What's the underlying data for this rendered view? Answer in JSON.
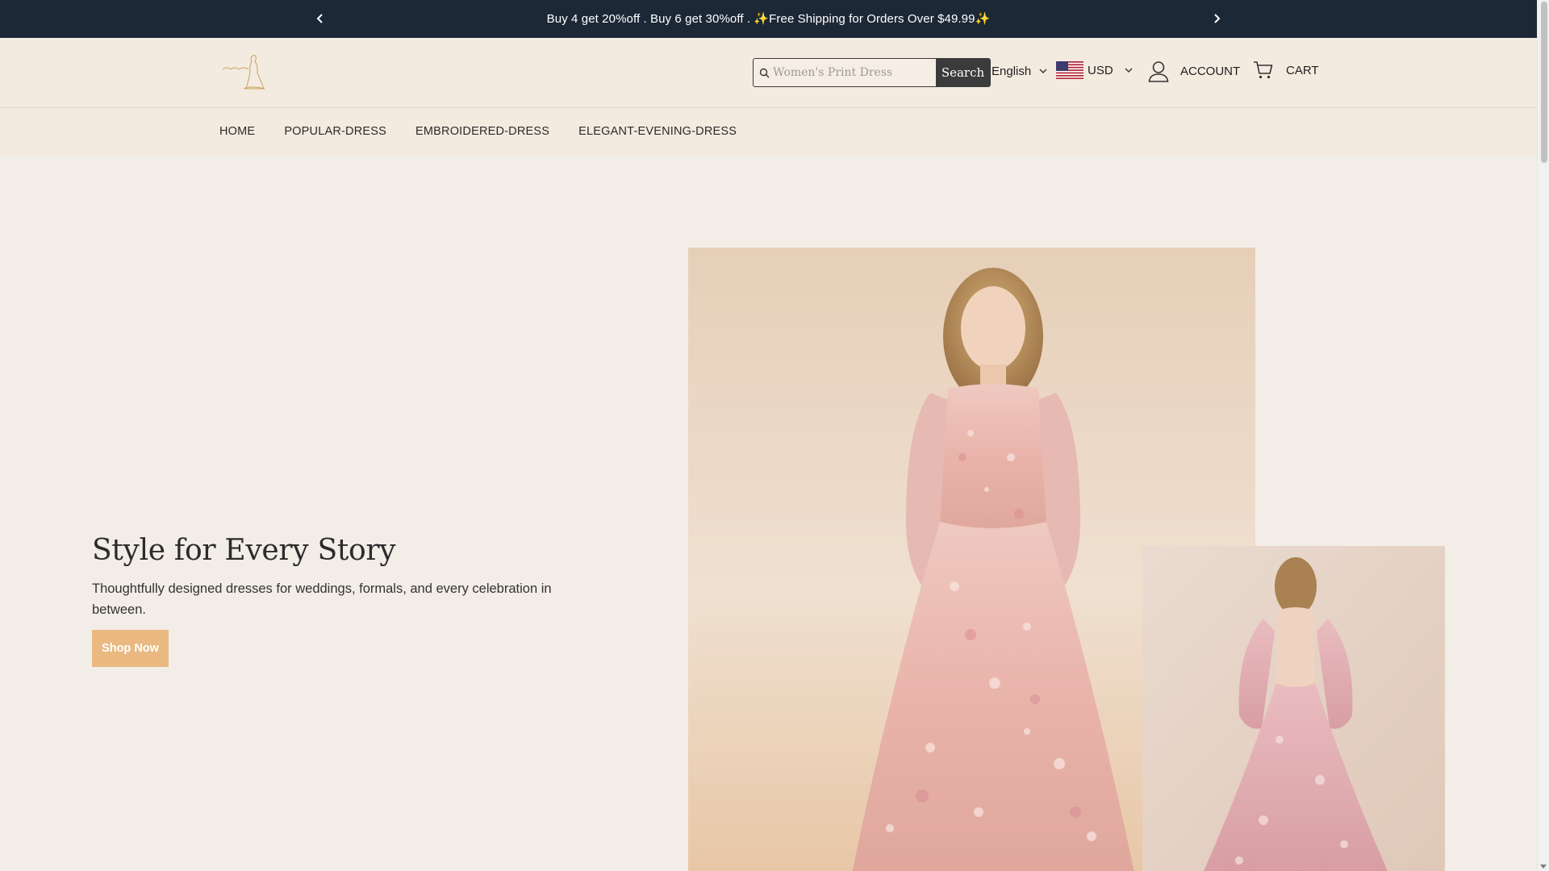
{
  "announcement": {
    "message": "Buy 4 get 20%off . Buy 6 get 30%off . ✨Free Shipping for Orders Over $49.99✨",
    "prev_icon": "chevron-left-icon",
    "next_icon": "chevron-right-icon"
  },
  "header": {
    "logo_icon": "bride-silhouette-logo",
    "search": {
      "placeholder": "Women's Print Dress",
      "value": "",
      "button_label": "Search"
    },
    "language": {
      "selected": "English"
    },
    "currency": {
      "selected": "USD",
      "flag_icon": "us-flag-icon"
    },
    "account_label": "ACCOUNT",
    "cart_label": "CART"
  },
  "nav": {
    "items": [
      {
        "label": "HOME"
      },
      {
        "label": "POPULAR-DRESS"
      },
      {
        "label": "EMBROIDERED-DRESS"
      },
      {
        "label": "ELEGANT-EVENING-DRESS"
      }
    ]
  },
  "hero": {
    "title": "Style for Every Story",
    "subtitle": "Thoughtfully designed dresses for weddings, formals, and every celebration in between.",
    "cta_label": "Shop Now"
  },
  "colors": {
    "announcement_bg": "#1d2836",
    "header_bg": "#f4ebe0",
    "page_bg": "#f3ede7",
    "cta_bg": "#e9b981",
    "search_button_bg": "#3b3b3b"
  }
}
